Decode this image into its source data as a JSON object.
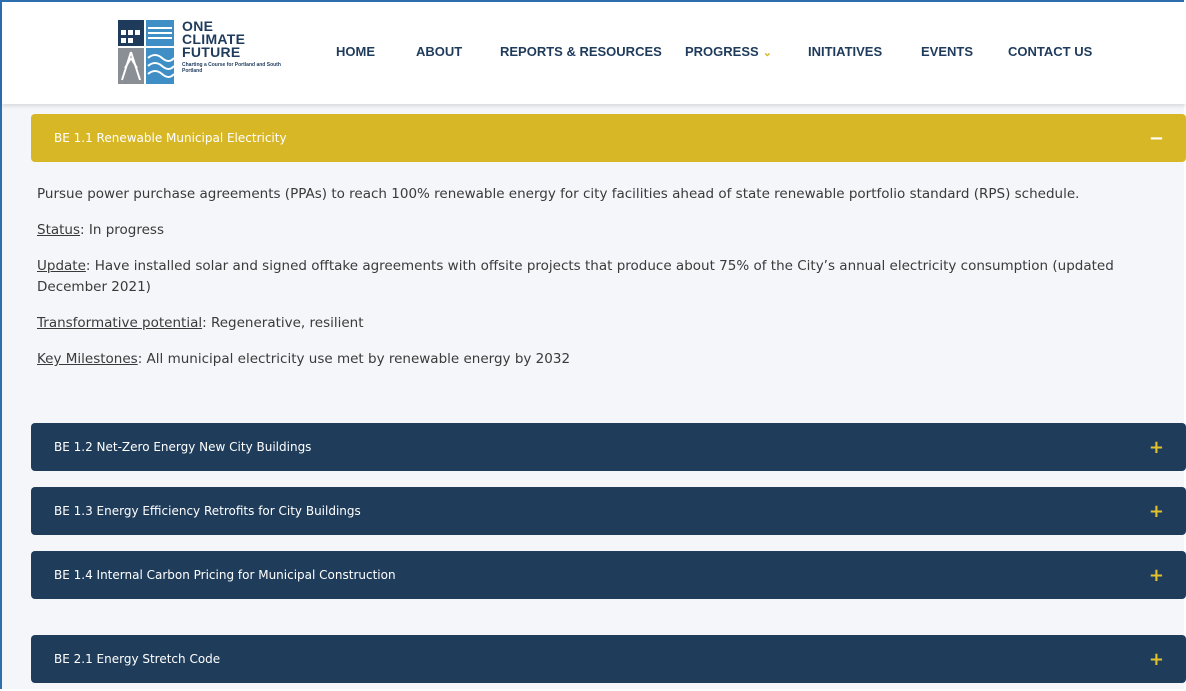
{
  "logo": {
    "line1": "ONE",
    "line2": "CLIMATE",
    "line3": "FUTURE",
    "tagline": "Charting a Course for Portland and South Portland",
    "colors": {
      "navy": "#1f3b5c",
      "blue": "#3f8fc6",
      "gray": "#8a8f95"
    }
  },
  "nav": {
    "items": [
      {
        "label": "HOME"
      },
      {
        "label": "ABOUT"
      },
      {
        "label": "REPORTS & RESOURCES"
      },
      {
        "label": "PROGRESS",
        "icon": "chevron-down-icon"
      },
      {
        "label": "INITIATIVES"
      },
      {
        "label": "EVENTS"
      },
      {
        "label": "CONTACT US"
      }
    ]
  },
  "accordion": {
    "open_panel": {
      "title": "BE 1.1 Renewable Municipal Electricity",
      "toggle": "−",
      "body": {
        "description": "Pursue power purchase agreements (PPAs) to reach 100% renewable energy for city facilities ahead of state renewable portfolio standard (RPS) schedule.",
        "status_label": "Status",
        "status_value": ": In progress",
        "update_label": "Update",
        "update_value": ": Have installed solar and signed offtake agreements with offsite projects that produce about 75% of the City’s annual electricity consumption (updated December 2021)",
        "potential_label": "Transformative potential",
        "potential_value": ": Regenerative, resilient",
        "milestones_label": "Key Milestones",
        "milestones_value": ": All municipal electricity use met by renewable energy by 2032"
      }
    },
    "closed_panels": [
      {
        "title": "BE 1.2 Net-Zero Energy New City Buildings",
        "toggle": "+"
      },
      {
        "title": "BE 1.3 Energy Efficiency Retrofits for City Buildings",
        "toggle": "+"
      },
      {
        "title": "BE 1.4 Internal Carbon Pricing for Municipal Construction",
        "toggle": "+"
      },
      {
        "title": "BE 2.1 Energy Stretch Code",
        "toggle": "+"
      }
    ]
  },
  "colors": {
    "accent_gold": "#d8b726",
    "panel_navy": "#1f3d5a",
    "nav_text": "#1f3b5c"
  }
}
